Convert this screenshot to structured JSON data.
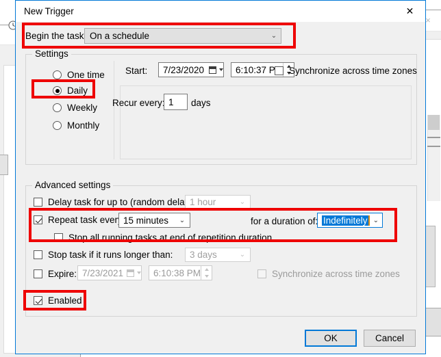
{
  "background": {
    "left_window": {
      "icon": "clock-icon"
    },
    "right_window": {
      "close_label": "×"
    }
  },
  "dialog": {
    "title": "New Trigger",
    "close_label": "✕",
    "begin_task": {
      "label": "Begin the task:",
      "value": "On a schedule",
      "arrow": "⌄"
    },
    "settings": {
      "group_title": "Settings",
      "schedule_options": [
        {
          "label": "One time",
          "checked": false
        },
        {
          "label": "Daily",
          "checked": true
        },
        {
          "label": "Weekly",
          "checked": false
        },
        {
          "label": "Monthly",
          "checked": false
        }
      ],
      "start_label": "Start:",
      "start_date": "7/23/2020",
      "start_time": "6:10:37 PM",
      "sync_label": "Synchronize across time zones",
      "sync_checked": false,
      "recur_label": "Recur every:",
      "recur_value": "1",
      "recur_unit": "days"
    },
    "advanced": {
      "group_title": "Advanced settings",
      "delay_label": "Delay task for up to (random delay):",
      "delay_checked": false,
      "delay_value": "1 hour",
      "repeat_label": "Repeat task every:",
      "repeat_checked": true,
      "repeat_value": "15 minutes",
      "duration_label": "for a duration of:",
      "duration_value": "Indefinitely",
      "stop_all_label": "Stop all running tasks at end of repetition duration",
      "stop_all_checked": false,
      "stop_task_label": "Stop task if it runs longer than:",
      "stop_task_checked": false,
      "stop_task_value": "3 days",
      "expire_label": "Expire:",
      "expire_checked": false,
      "expire_date": "7/23/2021",
      "expire_time": "6:10:38 PM",
      "expire_sync_label": "Synchronize across time zones",
      "expire_sync_checked": false,
      "enabled_label": "Enabled",
      "enabled_checked": true,
      "arrow": "⌄"
    },
    "buttons": {
      "ok": "OK",
      "cancel": "Cancel"
    }
  },
  "annotations": {
    "accent_color": "#ee0000",
    "highlight_color": "#0078d7",
    "boxes": [
      "begin-the-task-row",
      "daily-radio",
      "repeat-task-section",
      "enabled-checkbox"
    ]
  }
}
